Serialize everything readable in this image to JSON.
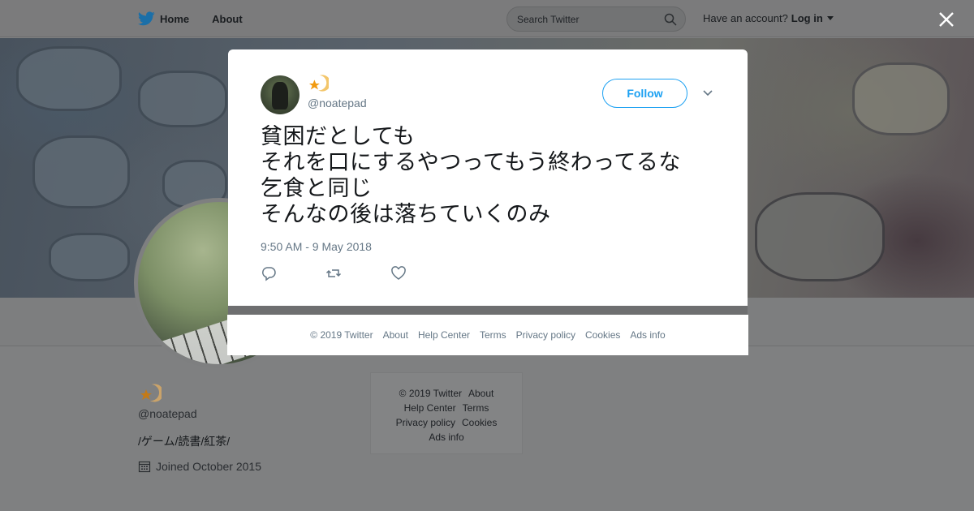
{
  "nav": {
    "home_label": "Home",
    "about_label": "About",
    "search_placeholder": "Search Twitter",
    "account_prompt": "Have an account?",
    "login_label": "Log in"
  },
  "tweet": {
    "handle": "@noatepad",
    "follow_label": "Follow",
    "lines": [
      "貧困だとしても",
      "それを口にするやつってもう終わってるな",
      "乞食と同じ",
      "そんなの後は落ちていくのみ"
    ],
    "timestamp": "9:50 AM - 9 May 2018"
  },
  "modal_footer": {
    "links": [
      "© 2019 Twitter",
      "About",
      "Help Center",
      "Terms",
      "Privacy policy",
      "Cookies",
      "Ads info"
    ]
  },
  "profile": {
    "handle": "@noatepad",
    "bio": "/ゲーム/読書/紅茶/",
    "joined": "Joined October 2015"
  },
  "side_footer": {
    "links": [
      "© 2019 Twitter",
      "About",
      "Help Center",
      "Terms",
      "Privacy policy",
      "Cookies",
      "Ads info"
    ]
  },
  "colors": {
    "accent": "#1da1f2",
    "muted": "#657786"
  },
  "icons": [
    "twitter-bird-icon",
    "search-icon",
    "close-icon",
    "chevron-down-icon",
    "reply-icon",
    "retweet-icon",
    "like-icon",
    "calendar-icon",
    "star-moon-emoji-icon"
  ]
}
